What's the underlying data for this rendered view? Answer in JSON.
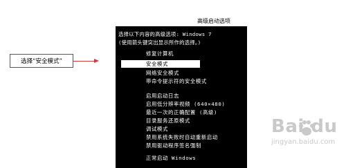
{
  "title": "高级启动选项",
  "prompt_line_1": "选择以下内容的高级选项: Windows 7",
  "prompt_line_2": "(使用箭头键突出显示所作的选择。)",
  "menu": [
    "修复计算机",
    "安全模式",
    "网络安全模式",
    "带命令提示符的安全模式",
    "启用启动日志",
    "启用低分辨率视频 (640×480)",
    "最近一次的正确配置 (高级)",
    "目录服务还原模式",
    "调试模式",
    "禁用系统失败时自动重新启动",
    "禁用驱动程序签名强制",
    "正常启动  Windows"
  ],
  "selected_index": 1,
  "callout_label": "选择“安全模式”",
  "watermark": {
    "brand": "Bai du",
    "url": "jingyan.baidu.com"
  },
  "colors": {
    "console_bg": "#000000",
    "console_text": "#ffffff",
    "arrow": "#cc3a3a"
  }
}
